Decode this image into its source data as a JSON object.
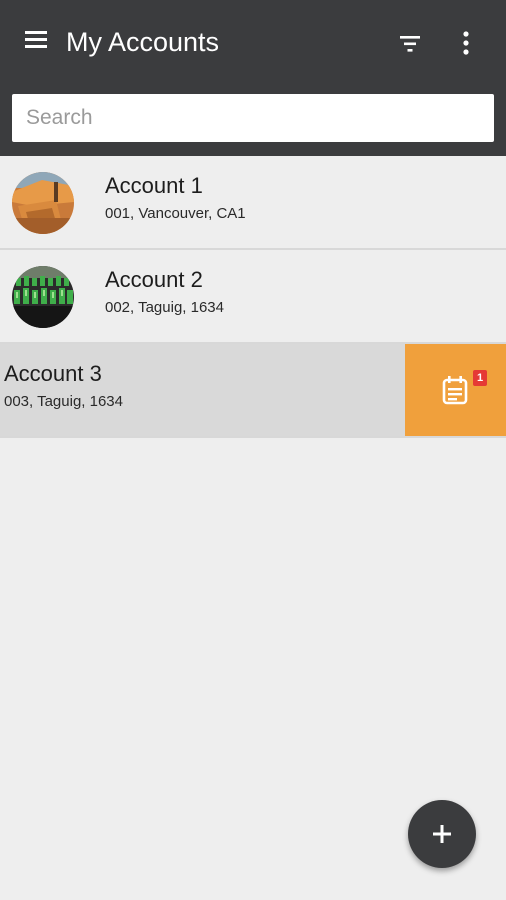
{
  "header": {
    "title": "My Accounts",
    "menu_icon": "hamburger-menu-icon",
    "filter_icon": "filter-icon",
    "more_icon": "more-vertical-icon"
  },
  "search": {
    "placeholder": "Search",
    "value": ""
  },
  "accounts": [
    {
      "name": "Account 1",
      "details": "001, Vancouver, CA1",
      "avatar": "construction-photo"
    },
    {
      "name": "Account 2",
      "details": "002, Taguig, 1634",
      "avatar": "bottles-photo"
    },
    {
      "name": "Account 3",
      "details": "003, Taguig, 1634",
      "action_icon": "calendar-icon",
      "badge": "1"
    }
  ],
  "fab": {
    "icon": "plus-icon"
  },
  "colors": {
    "toolbar": "#3b3c3e",
    "accent": "#f0a03c",
    "badge": "#e53935",
    "background": "#eeeeee"
  }
}
